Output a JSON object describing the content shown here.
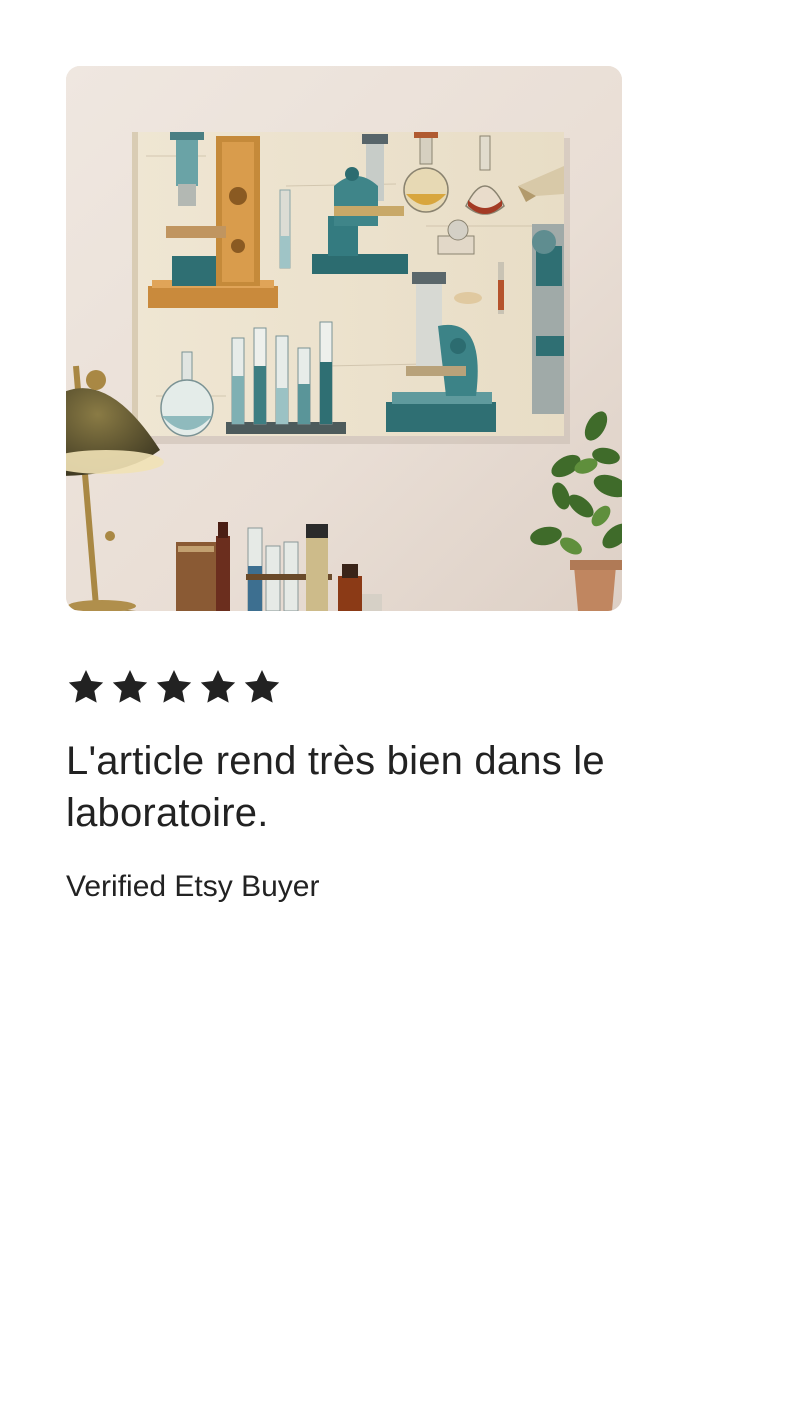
{
  "review": {
    "photo_alt": "Customer photo of vintage laboratory canvas print hanging on a wall",
    "rating": 5,
    "rating_max": 5,
    "star_color": "#222222",
    "text": "L'article rend très bien dans le laboratoire.",
    "reviewer": "Verified Etsy Buyer"
  }
}
